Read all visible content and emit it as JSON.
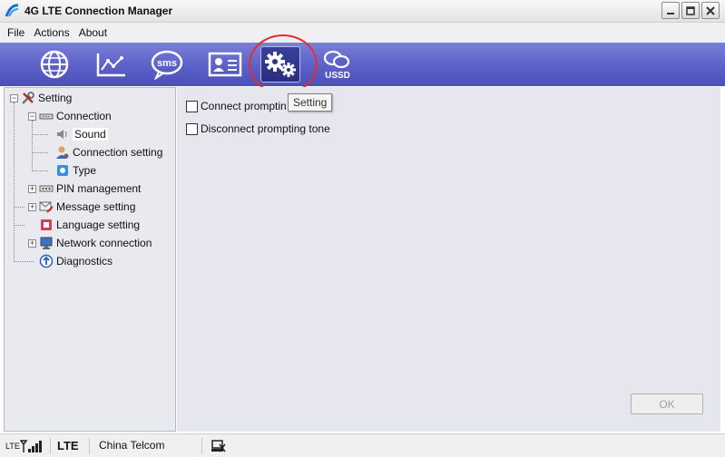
{
  "window": {
    "title": "4G LTE Connection Manager"
  },
  "menu": {
    "items": [
      "File",
      "Actions",
      "About"
    ]
  },
  "toolbar": {
    "buttons": [
      {
        "icon": "globe-icon"
      },
      {
        "icon": "chart-icon"
      },
      {
        "icon": "sms-icon",
        "label": "sms"
      },
      {
        "icon": "contacts-icon"
      },
      {
        "icon": "settings-gears-icon",
        "active": true
      },
      {
        "icon": "ussd-icon",
        "label": "USSD"
      }
    ],
    "tooltip": "Setting",
    "highlight_color": "#e03030"
  },
  "tree": {
    "root": "Setting",
    "items": [
      {
        "label": "Connection"
      },
      {
        "label": "Sound",
        "selected": true
      },
      {
        "label": "Connection setting"
      },
      {
        "label": "Type"
      },
      {
        "label": "PIN management"
      },
      {
        "label": "Message setting"
      },
      {
        "label": "Language setting"
      },
      {
        "label": "Network connection"
      },
      {
        "label": "Diagnostics"
      }
    ]
  },
  "content": {
    "options": [
      {
        "label": "Connect promptin",
        "checked": false
      },
      {
        "label": "Disconnect prompting tone",
        "checked": false
      }
    ],
    "ok_label": "OK"
  },
  "status": {
    "signal_label": "LTE",
    "network_type": "LTE",
    "operator": "China Telcom"
  },
  "colors": {
    "toolbar_top": "#7a7fd8",
    "toolbar_bottom": "#4a50b8",
    "panel_bg": "#e9e9f0"
  }
}
